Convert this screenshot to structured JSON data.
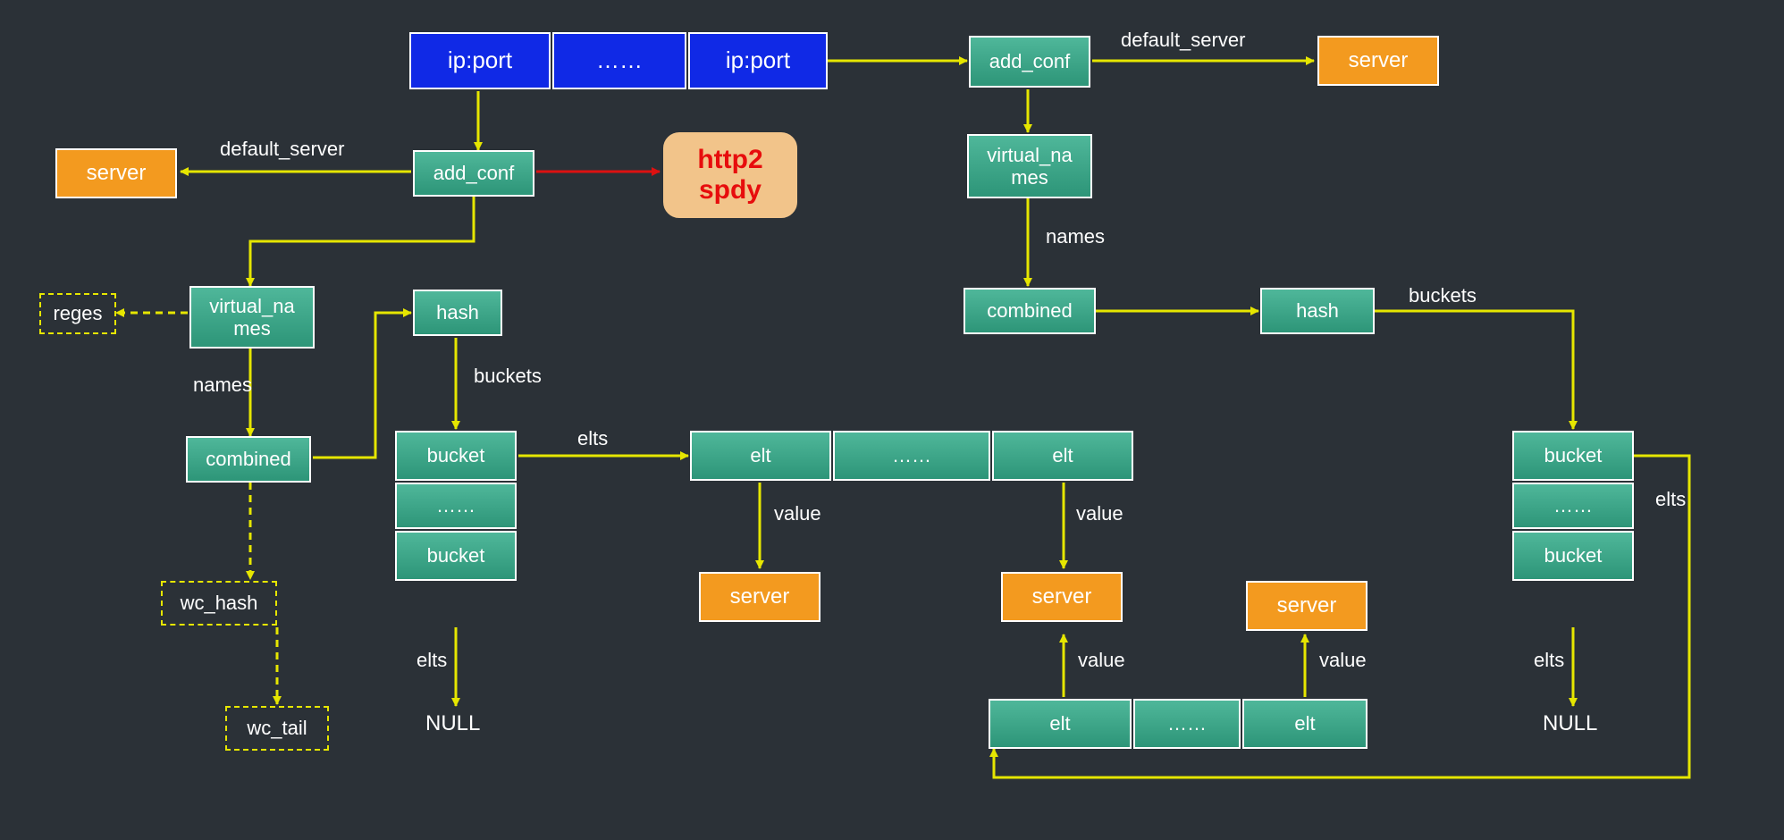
{
  "ipport1": "ip:port",
  "ipport_dots": "……",
  "ipport2": "ip:port",
  "add_conf": "add_conf",
  "server": "server",
  "default_server": "default_server",
  "virtual_names": "virtual_na\nmes",
  "names": "names",
  "http2_spdy": "http2\nspdy",
  "reges": "reges",
  "combined": "combined",
  "hash": "hash",
  "buckets": "buckets",
  "bucket": "bucket",
  "dots": "……",
  "elts": "elts",
  "elt": "elt",
  "value": "value",
  "wc_hash": "wc_hash",
  "wc_tail": "wc_tail",
  "null": "NULL"
}
